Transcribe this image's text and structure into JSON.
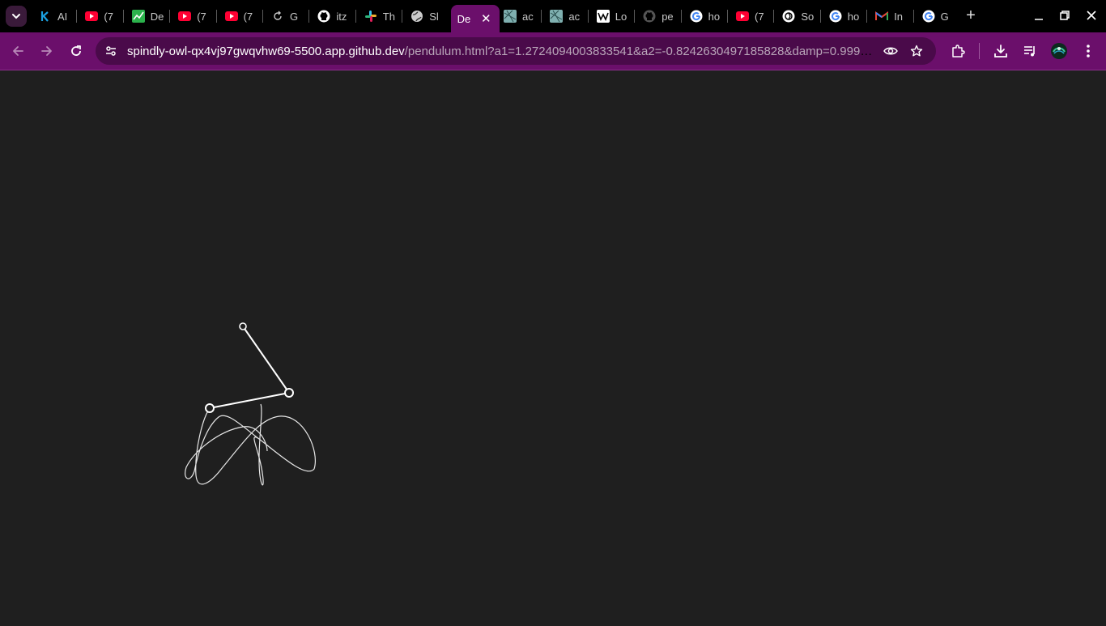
{
  "tabs": [
    {
      "title": "AI",
      "icon": "k-icon",
      "color": "#1aa0e0"
    },
    {
      "title": "(7",
      "icon": "youtube-icon",
      "color": "#ff0033"
    },
    {
      "title": "De",
      "icon": "chart-icon",
      "color": "#2bb24c"
    },
    {
      "title": "(7",
      "icon": "youtube-icon",
      "color": "#ff0033"
    },
    {
      "title": "(7",
      "icon": "youtube-icon",
      "color": "#ff0033"
    },
    {
      "title": "G",
      "icon": "refresh-arrow-icon",
      "color": "#cccccc"
    },
    {
      "title": "itz",
      "icon": "github-icon",
      "color": "#ffffff"
    },
    {
      "title": "Th",
      "icon": "slack-icon",
      "color": "#e01e5a"
    },
    {
      "title": "Sl",
      "icon": "globe-icon",
      "color": "#cccccc"
    },
    {
      "title": "De",
      "icon": "",
      "color": "#ffffff",
      "active": true
    },
    {
      "title": "ac",
      "icon": "map-icon",
      "color": "#7fb0b0"
    },
    {
      "title": "ac",
      "icon": "map-icon",
      "color": "#7fb0b0"
    },
    {
      "title": "Lo",
      "icon": "wikipedia-icon",
      "color": "#ffffff"
    },
    {
      "title": "pe",
      "icon": "github-icon",
      "color": "#555555"
    },
    {
      "title": "ho",
      "icon": "google-icon",
      "color": "#4285f4"
    },
    {
      "title": "(7",
      "icon": "youtube-icon",
      "color": "#ff0033"
    },
    {
      "title": "So",
      "icon": "openai-icon",
      "color": "#ffffff"
    },
    {
      "title": "ho",
      "icon": "google-icon",
      "color": "#4285f4"
    },
    {
      "title": "In",
      "icon": "gmail-icon",
      "color": "#ea4335"
    },
    {
      "title": "G",
      "icon": "google-icon",
      "color": "#4285f4"
    }
  ],
  "tabstrip": {
    "new_tab": "+",
    "close": "✕"
  },
  "window": {
    "minimize": "—",
    "maximize": "❐",
    "close": "✕"
  },
  "address_bar": {
    "host": "spindly-owl-qx4vj97gwqvhw69-5500.app.github.dev",
    "path": "/pendulum.html?a1=1.2724094003833541&a2=-0.8242630497185828&damp=0.999&..."
  },
  "colors": {
    "tabstrip_bg": "#000000",
    "toolbar_bg": "#6b0f6b",
    "omnibox_bg": "#4a0a4a",
    "page_bg": "#1f1f1f",
    "pendulum": "#ffffff"
  },
  "pendulum": {
    "a1": "1.2724094003833541",
    "a2": "-0.8242630497185828",
    "damp": "0.999"
  }
}
